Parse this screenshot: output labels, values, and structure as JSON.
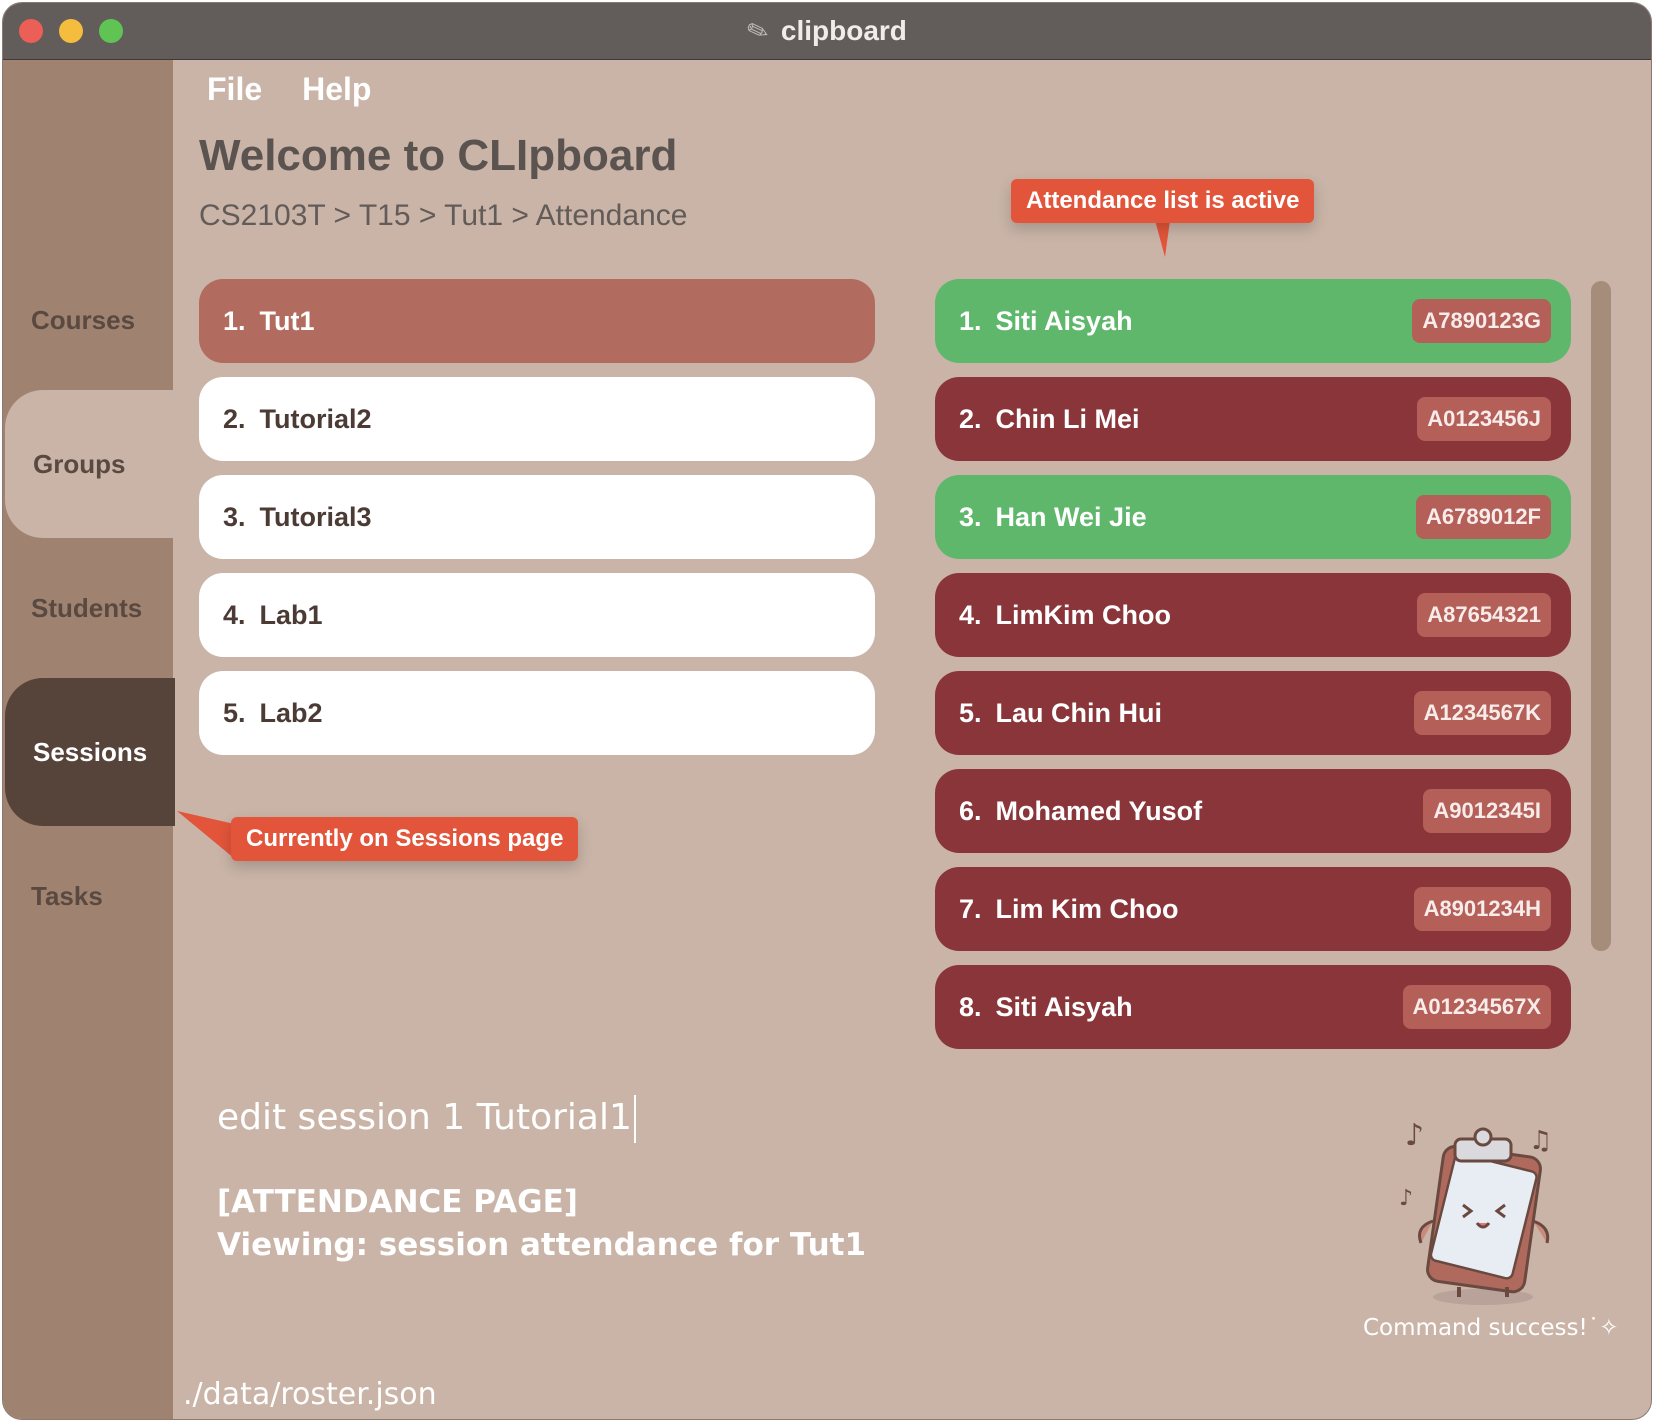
{
  "window": {
    "title": "clipboard",
    "title_icon": "clipboard-app-icon"
  },
  "menu": {
    "file": "File",
    "help": "Help"
  },
  "header": {
    "welcome": "Welcome to CLIpboard",
    "breadcrumb": "CS2103T > T15 > Tut1 > Attendance"
  },
  "sidebar": {
    "items": [
      {
        "label": "Courses"
      },
      {
        "label": "Groups"
      },
      {
        "label": "Students"
      },
      {
        "label": "Sessions",
        "active": true
      },
      {
        "label": "Tasks"
      }
    ]
  },
  "sessions": [
    {
      "num": "1.",
      "name": "Tut1",
      "selected": true
    },
    {
      "num": "2.",
      "name": "Tutorial2"
    },
    {
      "num": "3.",
      "name": "Tutorial3"
    },
    {
      "num": "4.",
      "name": "Lab1"
    },
    {
      "num": "5.",
      "name": "Lab2"
    }
  ],
  "attendance": [
    {
      "num": "1.",
      "name": "Siti Aisyah",
      "id": "A7890123G",
      "present": true
    },
    {
      "num": "2.",
      "name": "Chin Li Mei",
      "id": "A0123456J",
      "present": false
    },
    {
      "num": "3.",
      "name": "Han Wei Jie",
      "id": "A6789012F",
      "present": true
    },
    {
      "num": "4.",
      "name": "LimKim Choo",
      "id": "A87654321",
      "present": false
    },
    {
      "num": "5.",
      "name": "Lau Chin Hui",
      "id": "A1234567K",
      "present": false
    },
    {
      "num": "6.",
      "name": "Mohamed Yusof",
      "id": "A9012345I",
      "present": false
    },
    {
      "num": "7.",
      "name": "Lim Kim Choo",
      "id": "A8901234H",
      "present": false
    },
    {
      "num": "8.",
      "name": "Siti Aisyah",
      "id": "A01234567X",
      "present": false
    }
  ],
  "callouts": {
    "top": "Attendance list is active",
    "side": "Currently on Sessions page"
  },
  "command": {
    "value": "edit session 1 Tutorial1"
  },
  "result": {
    "line1": "[ATTENDANCE PAGE]",
    "line2": "Viewing: session attendance for Tut1"
  },
  "mascot": {
    "caption": "Command success!˙✧"
  },
  "footer": {
    "path": "./data/roster.json"
  },
  "colors": {
    "present": "#5fb76c",
    "absent": "#8a3539",
    "selected_group": "#b26b5f",
    "callout": "#e2553a"
  }
}
